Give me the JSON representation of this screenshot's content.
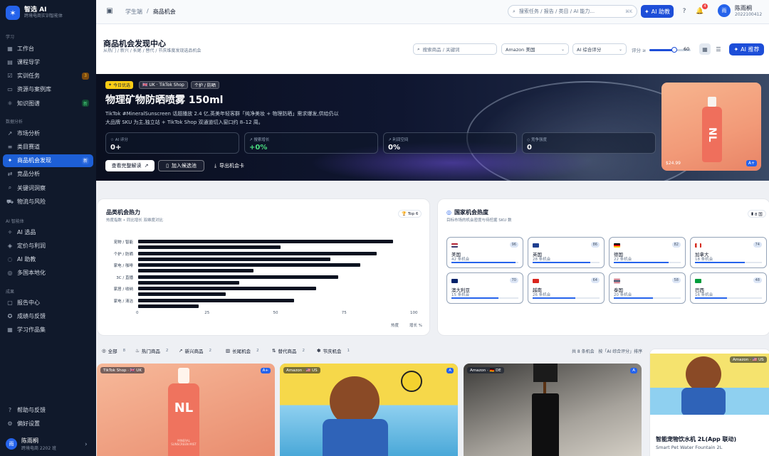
{
  "brand": {
    "name": "智选 AI",
    "sub": "跨境电商实训智能体"
  },
  "sidebar": {
    "sections": [
      {
        "label": "学习",
        "items": [
          {
            "label": "工作台",
            "icon": "grid-icon"
          },
          {
            "label": "课程导学",
            "icon": "book-icon"
          },
          {
            "label": "实训任务",
            "icon": "task-icon",
            "badge": "3"
          },
          {
            "label": "资源与案例库",
            "icon": "folder-icon"
          },
          {
            "label": "知识图谱",
            "icon": "graph-icon",
            "badge": "新"
          }
        ]
      },
      {
        "label": "数据分析",
        "items": [
          {
            "label": "市场分析",
            "icon": "chart-line-icon"
          },
          {
            "label": "类目赛道",
            "icon": "layers-icon"
          },
          {
            "label": "商品机会发现",
            "icon": "sparkle-icon",
            "badge": "新",
            "active": true
          },
          {
            "label": "竞品分析",
            "icon": "compare-icon"
          },
          {
            "label": "关键词洞察",
            "icon": "search-icon"
          },
          {
            "label": "物流与风险",
            "icon": "truck-icon"
          }
        ]
      },
      {
        "label": "AI 智能体",
        "items": [
          {
            "label": "AI 选品",
            "icon": "ai-icon"
          },
          {
            "label": "定价与利润",
            "icon": "tag-icon"
          },
          {
            "label": "AI 助教",
            "icon": "chat-icon"
          },
          {
            "label": "多国本地化",
            "icon": "globe-icon"
          }
        ]
      },
      {
        "label": "成果",
        "items": [
          {
            "label": "报告中心",
            "icon": "doc-icon"
          },
          {
            "label": "成绩与反馈",
            "icon": "medal-icon"
          },
          {
            "label": "学习作品集",
            "icon": "portfolio-icon"
          }
        ]
      }
    ],
    "bottom": [
      {
        "label": "帮助与反馈",
        "icon": "help-icon"
      },
      {
        "label": "偏好设置",
        "icon": "gear-icon"
      }
    ],
    "user": {
      "avatar": "雨",
      "name": "陈雨桐",
      "sub": "跨境电商 2202 班"
    }
  },
  "topbar": {
    "crumb_root": "学生端",
    "crumb_sep": "/",
    "crumb_current": "商品机会",
    "search_placeholder": "搜索任务 / 报告 / 类目 / AI 能力...",
    "shortcut": "⌘K",
    "ai_button": "AI 助教",
    "notif_count": "4",
    "user": {
      "avatar": "雨",
      "name": "陈雨桐",
      "id": "2022100412"
    }
  },
  "header": {
    "title": "商品机会发现中心",
    "subtitle": "从热门 / 新兴 / 长尾 / 替代 / 节庆维度发现选品机会",
    "search_placeholder": "搜索商品 / 关键词",
    "market": "Amazon 美国",
    "sort": "AI 综合评分",
    "score_label": "评分 ≥",
    "score_value": "60",
    "score_fraction": 0.6,
    "recommend": "AI 推荐"
  },
  "hero": {
    "chip_today": "今日优选",
    "chip_market": "🇬🇧 UK · TikTok Shop",
    "chip_cat": "个护 / 防晒",
    "title": "物理矿物防晒喷雾 150ml",
    "desc": "TikTok #MineralSunscreen 话题播放 2.4 亿,英美年轻客群「纯净美妆 + 物理防晒」需求爆发,供给仍以大品牌 SKU 为主,独立站 + TikTok Shop 双通道切入窗口约 8–12 周。",
    "stats": [
      {
        "label": "AI 评分",
        "value": "0+"
      },
      {
        "label": "搜索增长",
        "value": "+0%"
      },
      {
        "label": "利润空间",
        "value": "0%"
      },
      {
        "label": "竞争强度",
        "value": "0"
      }
    ],
    "btn_read": "查看完整解读",
    "btn_add": "加入候选池",
    "btn_export": "导出机会卡",
    "price": "$24.99",
    "rating": "A+",
    "bottle_text": "NL"
  },
  "heat": {
    "title": "品类机会热力",
    "sub": "热度指数 • 同比增长 双维度对比",
    "pill": "Top 6",
    "categories": [
      "宠物 / 智能",
      "个护 / 防晒",
      "家电 / 咖啡",
      "3C / 直播",
      "家居 / 收纳",
      "家电 / 清洁"
    ],
    "heat_values": [
      93,
      87,
      81,
      73,
      65,
      57
    ],
    "growth_values": [
      52,
      70,
      42,
      37,
      32,
      22
    ],
    "xticks": [
      "0",
      "25",
      "50",
      "75",
      "100"
    ],
    "legend_heat": "热度",
    "legend_growth": "增长 %",
    "xlim": [
      0,
      100
    ]
  },
  "country": {
    "title": "国家机会热度",
    "sub": "目标市场的机会密度与待挖掘 SKU 数",
    "pill": "8 国",
    "items": [
      {
        "name": "美国",
        "count": "42 条机会",
        "score": "96",
        "flag": "us-flag-icon",
        "fill": 0.96
      },
      {
        "name": "英国",
        "count": "28 条机会",
        "score": "86",
        "flag": "uk-flag-icon",
        "fill": 0.86
      },
      {
        "name": "德国",
        "count": "22 条机会",
        "score": "82",
        "flag": "de-flag-icon",
        "fill": 0.82
      },
      {
        "name": "加拿大",
        "count": "18 条机会",
        "score": "74",
        "flag": "ca-flag-icon",
        "fill": 0.74
      },
      {
        "name": "澳大利亚",
        "count": "15 条机会",
        "score": "70",
        "flag": "au-flag-icon",
        "fill": 0.7
      },
      {
        "name": "越南",
        "count": "26 条机会",
        "score": "64",
        "flag": "vn-flag-icon",
        "fill": 0.64
      },
      {
        "name": "泰国",
        "count": "20 条机会",
        "score": "58",
        "flag": "th-flag-icon",
        "fill": 0.58
      },
      {
        "name": "巴西",
        "count": "16 条机会",
        "score": "48",
        "flag": "br-flag-icon",
        "fill": 0.48
      }
    ]
  },
  "filters": {
    "tabs": [
      {
        "label": "全部",
        "count": "8",
        "icon": "all-icon"
      },
      {
        "label": "热门商品",
        "count": "2",
        "icon": "fire-icon"
      },
      {
        "label": "新兴商品",
        "count": "2",
        "icon": "trend-icon"
      },
      {
        "label": "长尾机会",
        "count": "2",
        "icon": "bars-icon"
      },
      {
        "label": "替代商品",
        "count": "2",
        "icon": "swap-icon"
      },
      {
        "label": "节庆机会",
        "count": "1",
        "icon": "gift-icon"
      }
    ],
    "summary": "共 8 条机会",
    "sort": "按「AI 综合评分」排序"
  },
  "cards": [
    {
      "tag": "TikTok Shop · 🇬🇧 UK",
      "rating": "A+",
      "bottle_text": "NL",
      "bottle_label": "MINERAL SUNSCREEN MIST"
    },
    {
      "tag": "Amazon · 🇺🇸 US",
      "rating": "A"
    },
    {
      "tag": "Amazon · 🇩🇪 DE",
      "rating": "A"
    }
  ],
  "side_card": {
    "tag": "Amazon · 🇺🇸 US",
    "title": "智能宠物饮水机 2L(App 联动)",
    "sub": "Smart Pet Water Fountain 2L"
  },
  "colors": {
    "accent": "#1d4ed8",
    "sidebar": "#10192b",
    "active": "#1d5fd6"
  }
}
